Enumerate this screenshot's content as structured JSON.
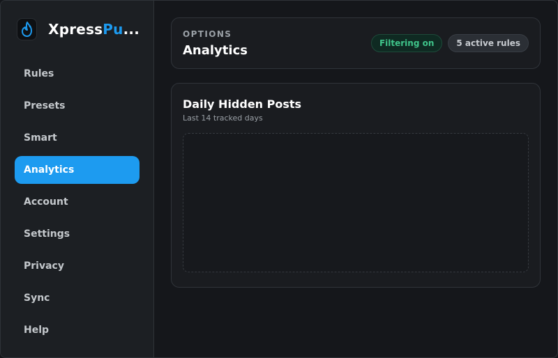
{
  "brand": {
    "name_part1": "Xpress",
    "name_part2": "Pu",
    "name_ellipsis": "...",
    "logo_icon": "flame-icon",
    "accent": "#1d9bf0"
  },
  "sidebar": {
    "items": [
      {
        "label": "Rules"
      },
      {
        "label": "Presets"
      },
      {
        "label": "Smart"
      },
      {
        "label": "Analytics",
        "active": true
      },
      {
        "label": "Account"
      },
      {
        "label": "Settings"
      },
      {
        "label": "Privacy"
      },
      {
        "label": "Sync"
      },
      {
        "label": "Help"
      }
    ]
  },
  "header": {
    "eyebrow": "OPTIONS",
    "title": "Analytics",
    "badges": {
      "filtering": "Filtering on",
      "rules": "5 active rules"
    }
  },
  "panel": {
    "title": "Daily Hidden Posts",
    "subtitle": "Last 14 tracked days"
  },
  "colors": {
    "background": "#15171b",
    "sidebar": "#1c1f23",
    "active_nav": "#1d9bf0",
    "status_ok": "#3fc48a"
  }
}
